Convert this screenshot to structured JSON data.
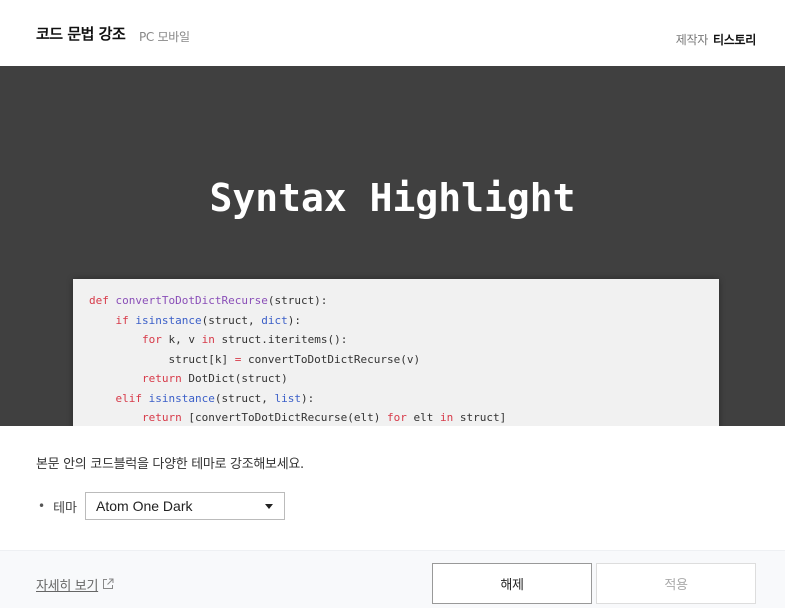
{
  "header": {
    "title": "코드 문법 강조",
    "subtitle": "PC 모바일",
    "maker_label": "제작자",
    "maker_value": "티스토리"
  },
  "hero": {
    "title": "Syntax Highlight",
    "code_lines": [
      [
        {
          "t": "def",
          "c": "kw"
        },
        {
          "t": " "
        },
        {
          "t": "convertToDotDictRecurse",
          "c": "fn"
        },
        {
          "t": "(struct):"
        }
      ],
      [
        {
          "t": "    "
        },
        {
          "t": "if",
          "c": "kw"
        },
        {
          "t": " "
        },
        {
          "t": "isinstance",
          "c": "bi"
        },
        {
          "t": "(struct, "
        },
        {
          "t": "dict",
          "c": "bi"
        },
        {
          "t": "):"
        }
      ],
      [
        {
          "t": "        "
        },
        {
          "t": "for",
          "c": "kw"
        },
        {
          "t": " k, v "
        },
        {
          "t": "in",
          "c": "kw"
        },
        {
          "t": " struct.iteritems():"
        }
      ],
      [
        {
          "t": "            struct[k] "
        },
        {
          "t": "=",
          "c": "kw"
        },
        {
          "t": " convertToDotDictRecurse(v)"
        }
      ],
      [
        {
          "t": "        "
        },
        {
          "t": "return",
          "c": "kw"
        },
        {
          "t": " DotDict(struct)"
        }
      ],
      [
        {
          "t": "    "
        },
        {
          "t": "elif",
          "c": "kw"
        },
        {
          "t": " "
        },
        {
          "t": "isinstance",
          "c": "bi"
        },
        {
          "t": "(struct, "
        },
        {
          "t": "list",
          "c": "bi"
        },
        {
          "t": "):"
        }
      ],
      [
        {
          "t": "        "
        },
        {
          "t": "return",
          "c": "kw"
        },
        {
          "t": " [convertToDotDictRecurse(elt) "
        },
        {
          "t": "for",
          "c": "kw"
        },
        {
          "t": " elt "
        },
        {
          "t": "in",
          "c": "kw"
        },
        {
          "t": " struct]"
        }
      ]
    ]
  },
  "settings": {
    "description": "본문 안의 코드블럭을 다양한 테마로 강조해보세요.",
    "bullet": "•",
    "theme_label": "테마",
    "theme_selected": "Atom One Dark"
  },
  "footer": {
    "more_link": "자세히 보기",
    "release_label": "해제",
    "apply_label": "적용"
  }
}
